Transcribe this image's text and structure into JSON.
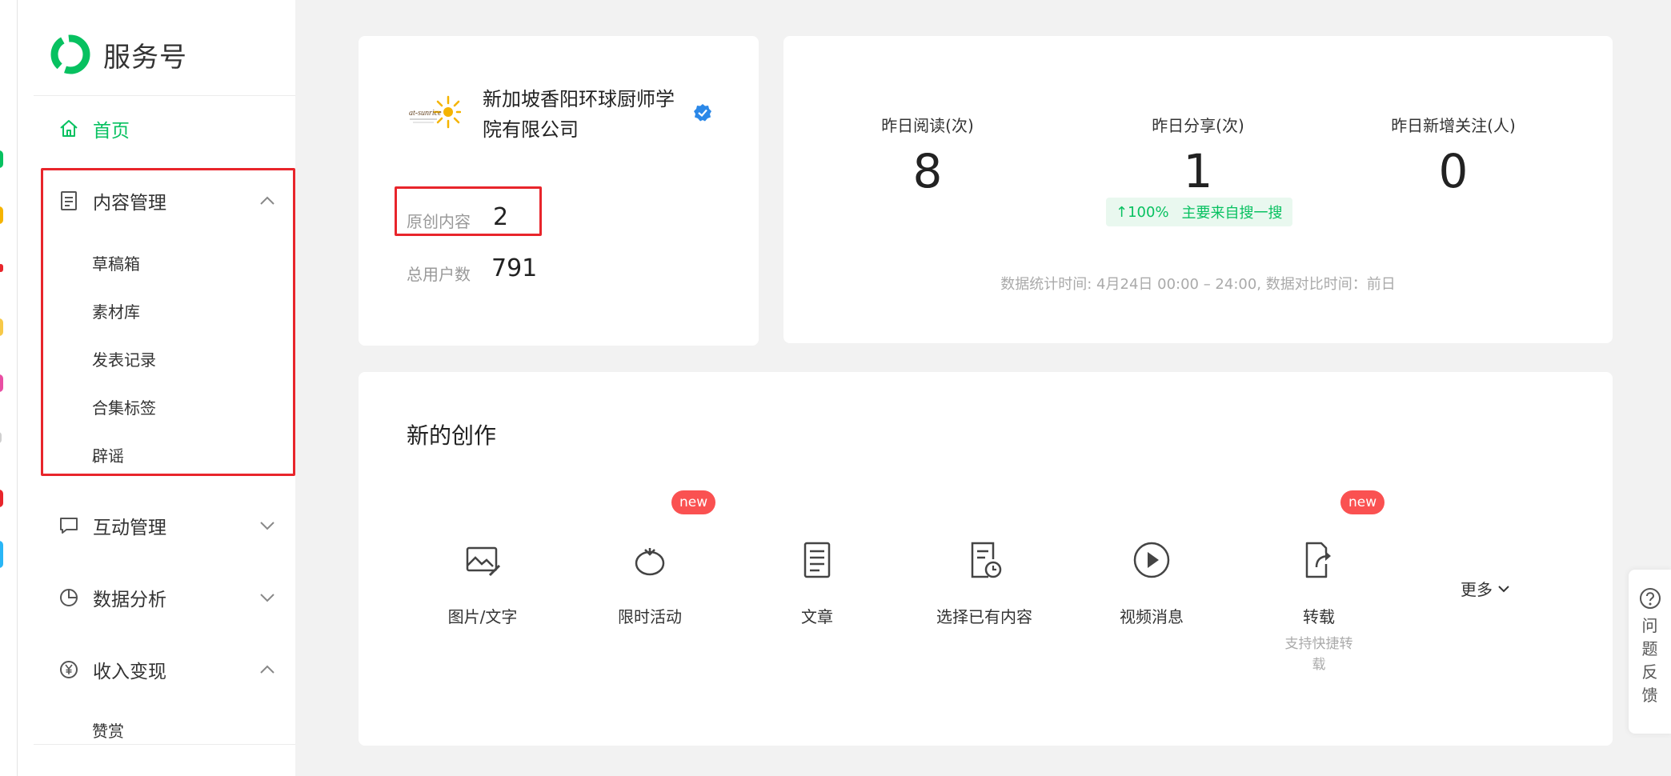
{
  "brand": {
    "name": "服务号",
    "color": "#07c160"
  },
  "sidebar": {
    "home": {
      "label": "首页",
      "icon": "home-icon"
    },
    "content": {
      "label": "内容管理",
      "icon": "document-icon",
      "items": [
        {
          "label": "草稿箱"
        },
        {
          "label": "素材库"
        },
        {
          "label": "发表记录"
        },
        {
          "label": "合集标签"
        },
        {
          "label": "辟谣"
        }
      ]
    },
    "interaction": {
      "label": "互动管理",
      "icon": "chat-icon"
    },
    "analytics": {
      "label": "数据分析",
      "icon": "pie-chart-icon"
    },
    "monetize": {
      "label": "收入变现",
      "icon": "yen-icon",
      "items": [
        {
          "label": "赞赏"
        }
      ]
    }
  },
  "account": {
    "name": "新加坡香阳环球厨师学院有限公司",
    "logo_text": "at-sunrice",
    "original_label": "原创内容",
    "original_value": "2",
    "users_label": "总用户数",
    "users_value": "791"
  },
  "yesterday": {
    "metrics": [
      {
        "label": "昨日阅读(次)",
        "value": "8"
      },
      {
        "label": "昨日分享(次)",
        "value": "1"
      },
      {
        "label": "昨日新增关注(人)",
        "value": "0"
      }
    ],
    "trend": {
      "change": "↑100%",
      "source": "主要来自搜一搜"
    },
    "note": "数据统计时间: 4月24日 00:00 – 24:00, 数据对比时间：前日"
  },
  "create": {
    "title": "新的创作",
    "new_badge": "new",
    "tools": [
      {
        "label": "图片/文字",
        "icon": "image-edit-icon"
      },
      {
        "label": "限时活动",
        "icon": "tomato-icon",
        "badge": "new"
      },
      {
        "label": "文章",
        "icon": "article-icon"
      },
      {
        "label": "选择已有内容",
        "icon": "doc-clock-icon"
      },
      {
        "label": "视频消息",
        "icon": "play-icon"
      },
      {
        "label": "转载",
        "icon": "share-doc-icon",
        "badge": "new",
        "sub": "支持快捷转载"
      }
    ],
    "more": "更多"
  },
  "feedback": {
    "label": "问题反馈",
    "icon": "question-icon"
  },
  "colors": {
    "accent": "#07c160",
    "highlight": "#e8252b",
    "badge": "#fa5151"
  }
}
